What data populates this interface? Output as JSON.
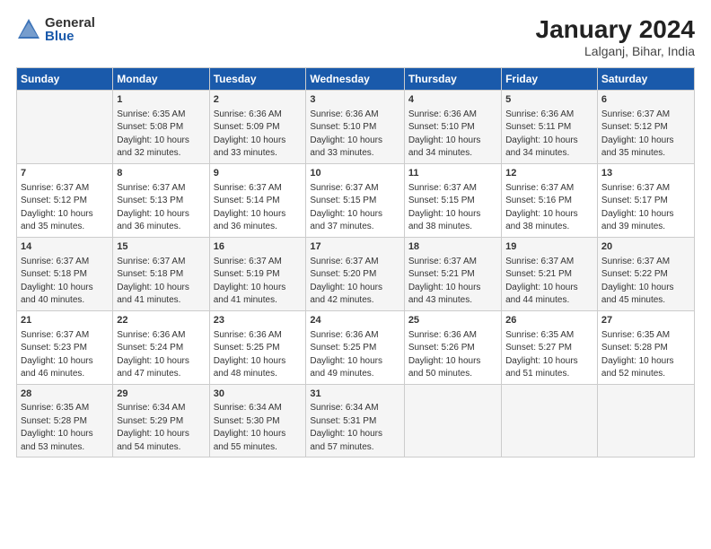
{
  "header": {
    "logo_general": "General",
    "logo_blue": "Blue",
    "month_year": "January 2024",
    "location": "Lalganj, Bihar, India"
  },
  "columns": [
    "Sunday",
    "Monday",
    "Tuesday",
    "Wednesday",
    "Thursday",
    "Friday",
    "Saturday"
  ],
  "weeks": [
    [
      {
        "day": "",
        "info": ""
      },
      {
        "day": "1",
        "info": "Sunrise: 6:35 AM\nSunset: 5:08 PM\nDaylight: 10 hours\nand 32 minutes."
      },
      {
        "day": "2",
        "info": "Sunrise: 6:36 AM\nSunset: 5:09 PM\nDaylight: 10 hours\nand 33 minutes."
      },
      {
        "day": "3",
        "info": "Sunrise: 6:36 AM\nSunset: 5:10 PM\nDaylight: 10 hours\nand 33 minutes."
      },
      {
        "day": "4",
        "info": "Sunrise: 6:36 AM\nSunset: 5:10 PM\nDaylight: 10 hours\nand 34 minutes."
      },
      {
        "day": "5",
        "info": "Sunrise: 6:36 AM\nSunset: 5:11 PM\nDaylight: 10 hours\nand 34 minutes."
      },
      {
        "day": "6",
        "info": "Sunrise: 6:37 AM\nSunset: 5:12 PM\nDaylight: 10 hours\nand 35 minutes."
      }
    ],
    [
      {
        "day": "7",
        "info": "Sunrise: 6:37 AM\nSunset: 5:12 PM\nDaylight: 10 hours\nand 35 minutes."
      },
      {
        "day": "8",
        "info": "Sunrise: 6:37 AM\nSunset: 5:13 PM\nDaylight: 10 hours\nand 36 minutes."
      },
      {
        "day": "9",
        "info": "Sunrise: 6:37 AM\nSunset: 5:14 PM\nDaylight: 10 hours\nand 36 minutes."
      },
      {
        "day": "10",
        "info": "Sunrise: 6:37 AM\nSunset: 5:15 PM\nDaylight: 10 hours\nand 37 minutes."
      },
      {
        "day": "11",
        "info": "Sunrise: 6:37 AM\nSunset: 5:15 PM\nDaylight: 10 hours\nand 38 minutes."
      },
      {
        "day": "12",
        "info": "Sunrise: 6:37 AM\nSunset: 5:16 PM\nDaylight: 10 hours\nand 38 minutes."
      },
      {
        "day": "13",
        "info": "Sunrise: 6:37 AM\nSunset: 5:17 PM\nDaylight: 10 hours\nand 39 minutes."
      }
    ],
    [
      {
        "day": "14",
        "info": "Sunrise: 6:37 AM\nSunset: 5:18 PM\nDaylight: 10 hours\nand 40 minutes."
      },
      {
        "day": "15",
        "info": "Sunrise: 6:37 AM\nSunset: 5:18 PM\nDaylight: 10 hours\nand 41 minutes."
      },
      {
        "day": "16",
        "info": "Sunrise: 6:37 AM\nSunset: 5:19 PM\nDaylight: 10 hours\nand 41 minutes."
      },
      {
        "day": "17",
        "info": "Sunrise: 6:37 AM\nSunset: 5:20 PM\nDaylight: 10 hours\nand 42 minutes."
      },
      {
        "day": "18",
        "info": "Sunrise: 6:37 AM\nSunset: 5:21 PM\nDaylight: 10 hours\nand 43 minutes."
      },
      {
        "day": "19",
        "info": "Sunrise: 6:37 AM\nSunset: 5:21 PM\nDaylight: 10 hours\nand 44 minutes."
      },
      {
        "day": "20",
        "info": "Sunrise: 6:37 AM\nSunset: 5:22 PM\nDaylight: 10 hours\nand 45 minutes."
      }
    ],
    [
      {
        "day": "21",
        "info": "Sunrise: 6:37 AM\nSunset: 5:23 PM\nDaylight: 10 hours\nand 46 minutes."
      },
      {
        "day": "22",
        "info": "Sunrise: 6:36 AM\nSunset: 5:24 PM\nDaylight: 10 hours\nand 47 minutes."
      },
      {
        "day": "23",
        "info": "Sunrise: 6:36 AM\nSunset: 5:25 PM\nDaylight: 10 hours\nand 48 minutes."
      },
      {
        "day": "24",
        "info": "Sunrise: 6:36 AM\nSunset: 5:25 PM\nDaylight: 10 hours\nand 49 minutes."
      },
      {
        "day": "25",
        "info": "Sunrise: 6:36 AM\nSunset: 5:26 PM\nDaylight: 10 hours\nand 50 minutes."
      },
      {
        "day": "26",
        "info": "Sunrise: 6:35 AM\nSunset: 5:27 PM\nDaylight: 10 hours\nand 51 minutes."
      },
      {
        "day": "27",
        "info": "Sunrise: 6:35 AM\nSunset: 5:28 PM\nDaylight: 10 hours\nand 52 minutes."
      }
    ],
    [
      {
        "day": "28",
        "info": "Sunrise: 6:35 AM\nSunset: 5:28 PM\nDaylight: 10 hours\nand 53 minutes."
      },
      {
        "day": "29",
        "info": "Sunrise: 6:34 AM\nSunset: 5:29 PM\nDaylight: 10 hours\nand 54 minutes."
      },
      {
        "day": "30",
        "info": "Sunrise: 6:34 AM\nSunset: 5:30 PM\nDaylight: 10 hours\nand 55 minutes."
      },
      {
        "day": "31",
        "info": "Sunrise: 6:34 AM\nSunset: 5:31 PM\nDaylight: 10 hours\nand 57 minutes."
      },
      {
        "day": "",
        "info": ""
      },
      {
        "day": "",
        "info": ""
      },
      {
        "day": "",
        "info": ""
      }
    ]
  ]
}
